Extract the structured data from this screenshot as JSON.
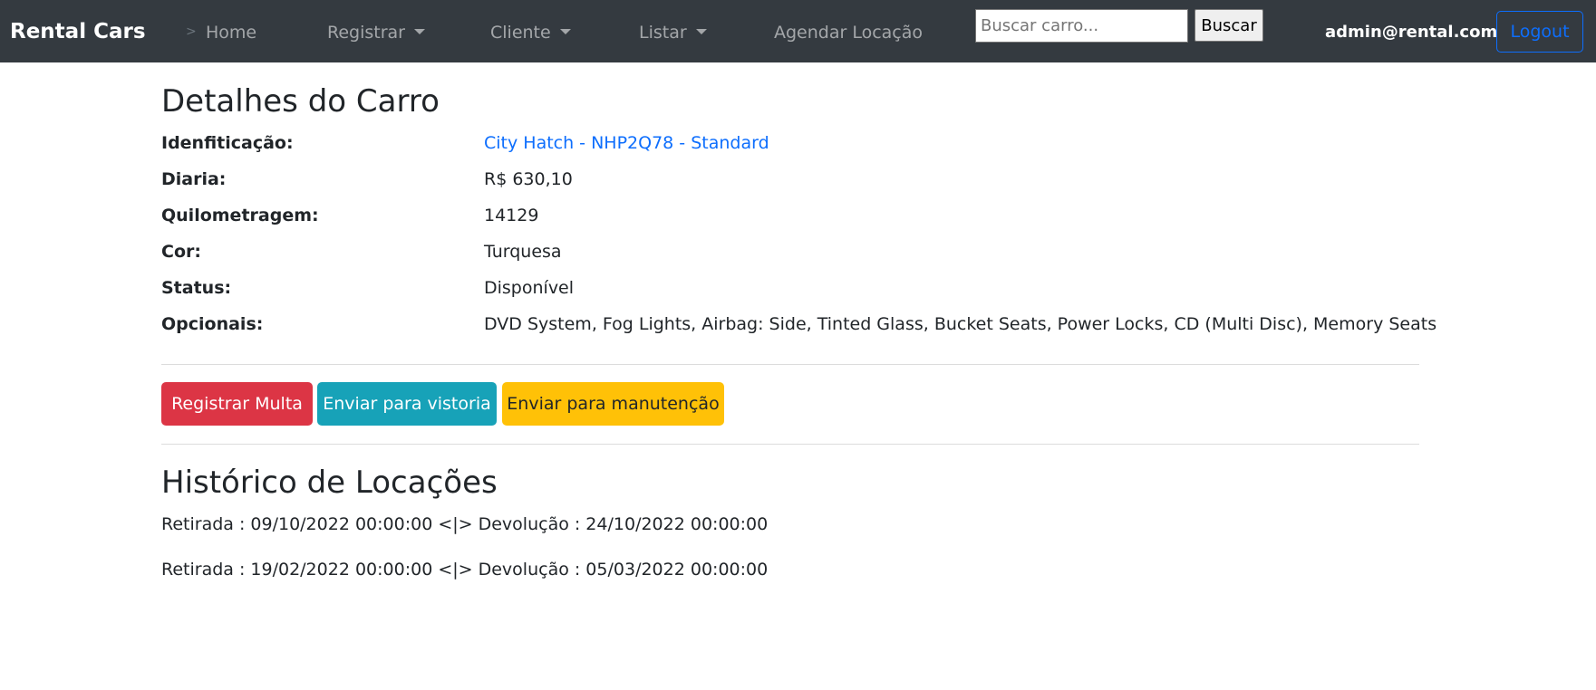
{
  "navbar": {
    "brand": "Rental Cars",
    "arrow": ">",
    "items": [
      {
        "label": "Home"
      },
      {
        "label": "Registrar"
      },
      {
        "label": "Cliente"
      },
      {
        "label": "Listar"
      },
      {
        "label": "Agendar Locação"
      }
    ],
    "search": {
      "placeholder": "Buscar carro...",
      "value": "",
      "button_label": "Buscar"
    },
    "user_email": "admin@rental.com",
    "logout_label": "Logout"
  },
  "main": {
    "title": "Detalhes do Carro",
    "details": [
      {
        "label": "Idenfiticação:",
        "value": "City Hatch - NHP2Q78 - Standard"
      },
      {
        "label": "Diaria:",
        "value": "R$ 630,10"
      },
      {
        "label": "Quilometragem:",
        "value": "14129"
      },
      {
        "label": "Cor:",
        "value": "Turquesa"
      },
      {
        "label": "Status:",
        "value": "Disponível"
      },
      {
        "label": "Opcionais:",
        "value": "DVD System, Fog Lights, Airbag: Side, Tinted Glass, Bucket Seats, Power Locks, CD (Multi Disc), Memory Seats"
      }
    ],
    "actions": {
      "fine_label": "Registrar Multa",
      "inspection_label": "Enviar para vistoria",
      "maintenance_label": "Enviar para manutenção"
    },
    "history_title": "Histórico de Locações",
    "history": [
      "Retirada : 09/10/2022 00:00:00 <|> Devolução : 24/10/2022 00:00:00",
      "Retirada : 19/02/2022 00:00:00 <|> Devolução : 05/03/2022 00:00:00"
    ]
  },
  "colors": {
    "navbar_bg": "#343a40",
    "link": "#0d6efd",
    "danger": "#dc3545",
    "info": "#17a2b8",
    "warning": "#ffc107"
  }
}
